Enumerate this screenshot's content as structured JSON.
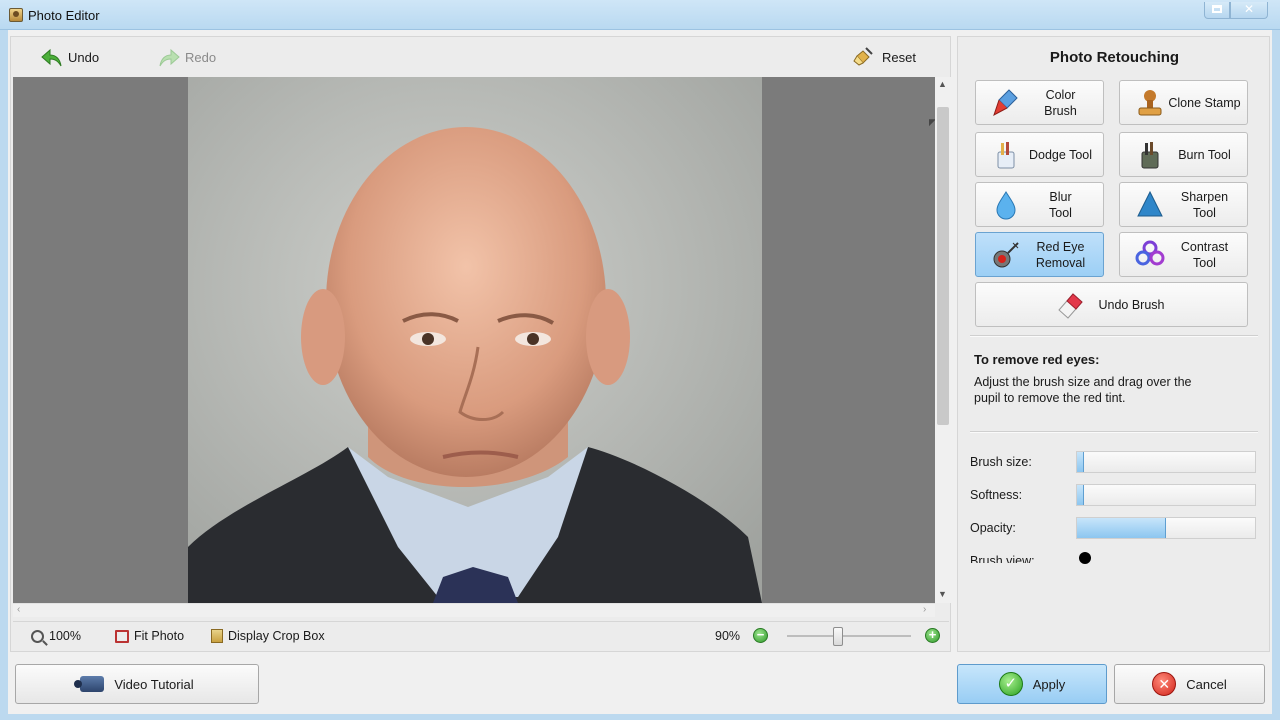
{
  "window": {
    "title": "Photo Editor"
  },
  "toolbar": {
    "undo": "Undo",
    "redo": "Redo",
    "reset": "Reset"
  },
  "statusbar": {
    "zoom_100": "100%",
    "fit_photo": "Fit Photo",
    "display_crop_box": "Display Crop Box",
    "zoom_level": "90%",
    "zoom_slider_value": 0.37
  },
  "panel": {
    "title": "Photo Retouching",
    "tools": [
      {
        "label": "Color\nBrush",
        "icon": "color-brush-icon"
      },
      {
        "label": "Clone Stamp",
        "icon": "clone-stamp-icon"
      },
      {
        "label": "Dodge Tool",
        "icon": "dodge-tool-icon"
      },
      {
        "label": "Burn Tool",
        "icon": "burn-tool-icon"
      },
      {
        "label": "Blur\nTool",
        "icon": "blur-tool-icon"
      },
      {
        "label": "Sharpen\nTool",
        "icon": "sharpen-tool-icon"
      },
      {
        "label": "Red Eye\nRemoval",
        "icon": "red-eye-icon",
        "active": true
      },
      {
        "label": "Contrast\nTool",
        "icon": "contrast-tool-icon"
      },
      {
        "label": "Undo Brush",
        "icon": "eraser-icon"
      }
    ],
    "help_title": "To remove red eyes:",
    "help_text": "Adjust the brush size and drag over the pupil to remove the red tint.",
    "sliders": [
      {
        "label": "Brush size:",
        "value": 0.04
      },
      {
        "label": "Softness:",
        "value": 0.04
      },
      {
        "label": "Opacity:",
        "value": 0.5
      }
    ],
    "brush_view_label": "Brush view:"
  },
  "buttons": {
    "video_tutorial": "Video Tutorial",
    "apply": "Apply",
    "cancel": "Cancel"
  },
  "colors": {
    "accent": "#9ccff5",
    "title_bar": "#b9d9f1",
    "apply_green": "#29a020",
    "cancel_red": "#d1231a"
  }
}
